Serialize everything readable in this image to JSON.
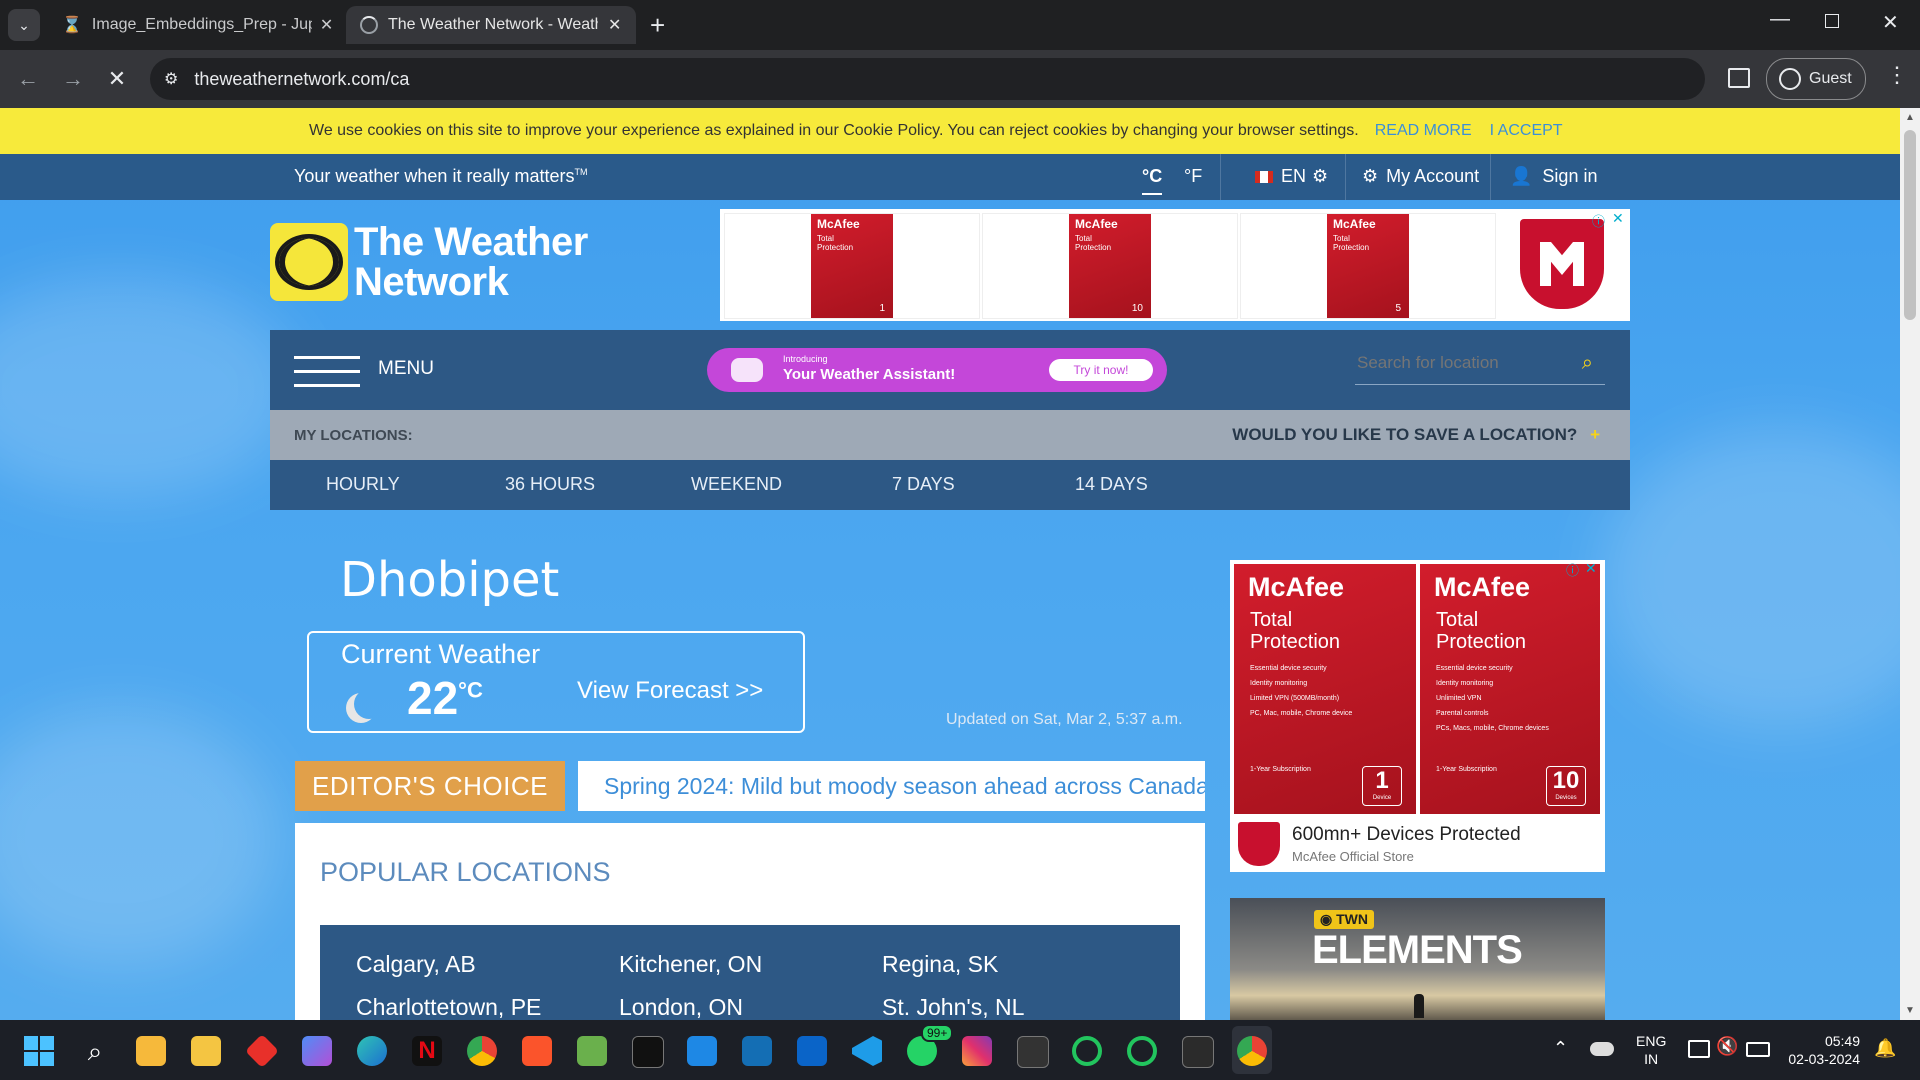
{
  "browser": {
    "tabs": [
      {
        "title": "Image_Embeddings_Prep - Jupyter"
      },
      {
        "title": "The Weather Network - Weather"
      }
    ],
    "url": "theweathernetwork.com/ca",
    "profile": "Guest"
  },
  "cookie_banner": {
    "text": "We use cookies on this site to improve your experience as explained in our Cookie Policy. You can reject cookies by changing your browser settings.",
    "read_more": "READ MORE",
    "accept": "I ACCEPT"
  },
  "topbar": {
    "tagline": "Your weather when it really matters",
    "tm": "TM",
    "celsius": "°C",
    "fahrenheit": "°F",
    "lang": "EN",
    "my_account": "My Account",
    "sign_in": "Sign in"
  },
  "logo": {
    "line1": "The Weather",
    "line2": "Network"
  },
  "ad_top": {
    "brand": "McAfee",
    "product": "Total Protection",
    "counts": [
      "1",
      "10",
      "5"
    ]
  },
  "nav": {
    "menu": "MENU",
    "promo_intro": "Introducing",
    "promo_title": "Your Weather Assistant!",
    "promo_cta": "Try it now!",
    "search_placeholder": "Search for location"
  },
  "my_locations": {
    "label": "MY LOCATIONS:",
    "save_prompt": "WOULD YOU LIKE TO SAVE A LOCATION?",
    "plus": "+"
  },
  "forecast_tabs": [
    "HOURLY",
    "36 HOURS",
    "WEEKEND",
    "7 DAYS",
    "14 DAYS"
  ],
  "location": {
    "city": "Dhobipet",
    "current_label": "Current Weather",
    "temp": "22",
    "unit": "°C",
    "view_forecast": "View Forecast >>",
    "updated": "Updated on Sat, Mar 2, 5:37 a.m."
  },
  "editors_choice": {
    "label": "EDITOR'S CHOICE",
    "headline": "Spring 2024: Mild but moody season ahead across Canada"
  },
  "popular": {
    "title": "POPULAR LOCATIONS",
    "rows": [
      [
        "Calgary, AB",
        "Kitchener, ON",
        "Regina, SK"
      ],
      [
        "Charlottetown, PE",
        "London, ON",
        "St. John's, NL"
      ]
    ]
  },
  "ad_side": {
    "products": [
      {
        "title": "Total Protection",
        "features": [
          "Essential device security",
          "Identity monitoring",
          "Limited VPN (500MB/month)",
          "PC, Mac, mobile, Chrome device"
        ],
        "sub": "1-Year Subscription",
        "count": "1",
        "unit": "Device"
      },
      {
        "title": "Total Protection",
        "features": [
          "Essential device security",
          "Identity monitoring",
          "Unlimited VPN",
          "Parental controls",
          "PCs, Macs, mobile, Chrome devices"
        ],
        "sub": "1-Year Subscription",
        "count": "10",
        "unit": "Devices"
      }
    ],
    "tagline": "600mn+ Devices Protected",
    "store": "McAfee Official Store"
  },
  "elements_ad": {
    "badge": "TWN",
    "title": "ELEMENTS"
  },
  "taskbar": {
    "lang1": "ENG",
    "lang2": "IN",
    "time": "05:49",
    "date": "02-03-2024",
    "whatsapp_badge": "99+"
  }
}
